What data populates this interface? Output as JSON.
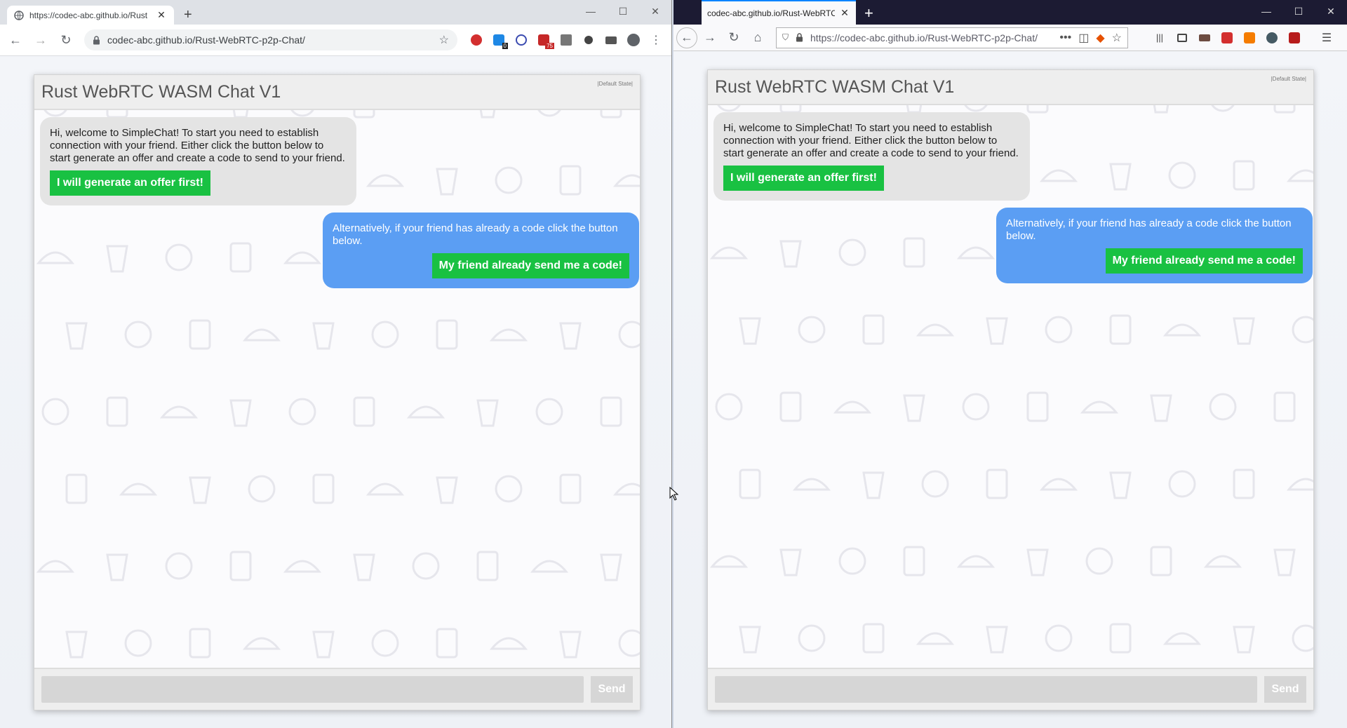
{
  "chrome": {
    "tab_title": "https://codec-abc.github.io/Rust",
    "url": "codec-abc.github.io/Rust-WebRTC-p2p-Chat/",
    "window_controls": [
      "—",
      "☐",
      "✕"
    ],
    "extension_badges": {
      "badge_a": "0",
      "badge_b": "75"
    }
  },
  "firefox": {
    "tab_title": "codec-abc.github.io/Rust-WebRTC",
    "url": "https://codec-abc.github.io/Rust-WebRTC-p2p-Chat/",
    "url_overflow": "•••",
    "window_controls": [
      "—",
      "☐",
      "✕"
    ]
  },
  "chat": {
    "title": "Rust WebRTC WASM Chat V1",
    "state": "|Default State|",
    "welcome_text": "Hi, welcome to SimpleChat! To start you need to establish connection with your friend. Either click the button below to start generate an offer and create a code to send to your friend.",
    "offer_button": "I will generate an offer first!",
    "alt_text": "Alternatively, if your friend has already a code click the button below.",
    "code_button": "My friend already send me a code!",
    "input_placeholder": "",
    "send_label": "Send"
  },
  "colors": {
    "bubble_left": "#e4e4e4",
    "bubble_right": "#5b9ef3",
    "button_green": "#19c142",
    "header": "#eeeeee"
  },
  "icons": [
    "lock-icon",
    "star-icon",
    "back-icon",
    "forward-icon",
    "reload-icon",
    "home-icon",
    "menu-icon",
    "profile-icon"
  ]
}
